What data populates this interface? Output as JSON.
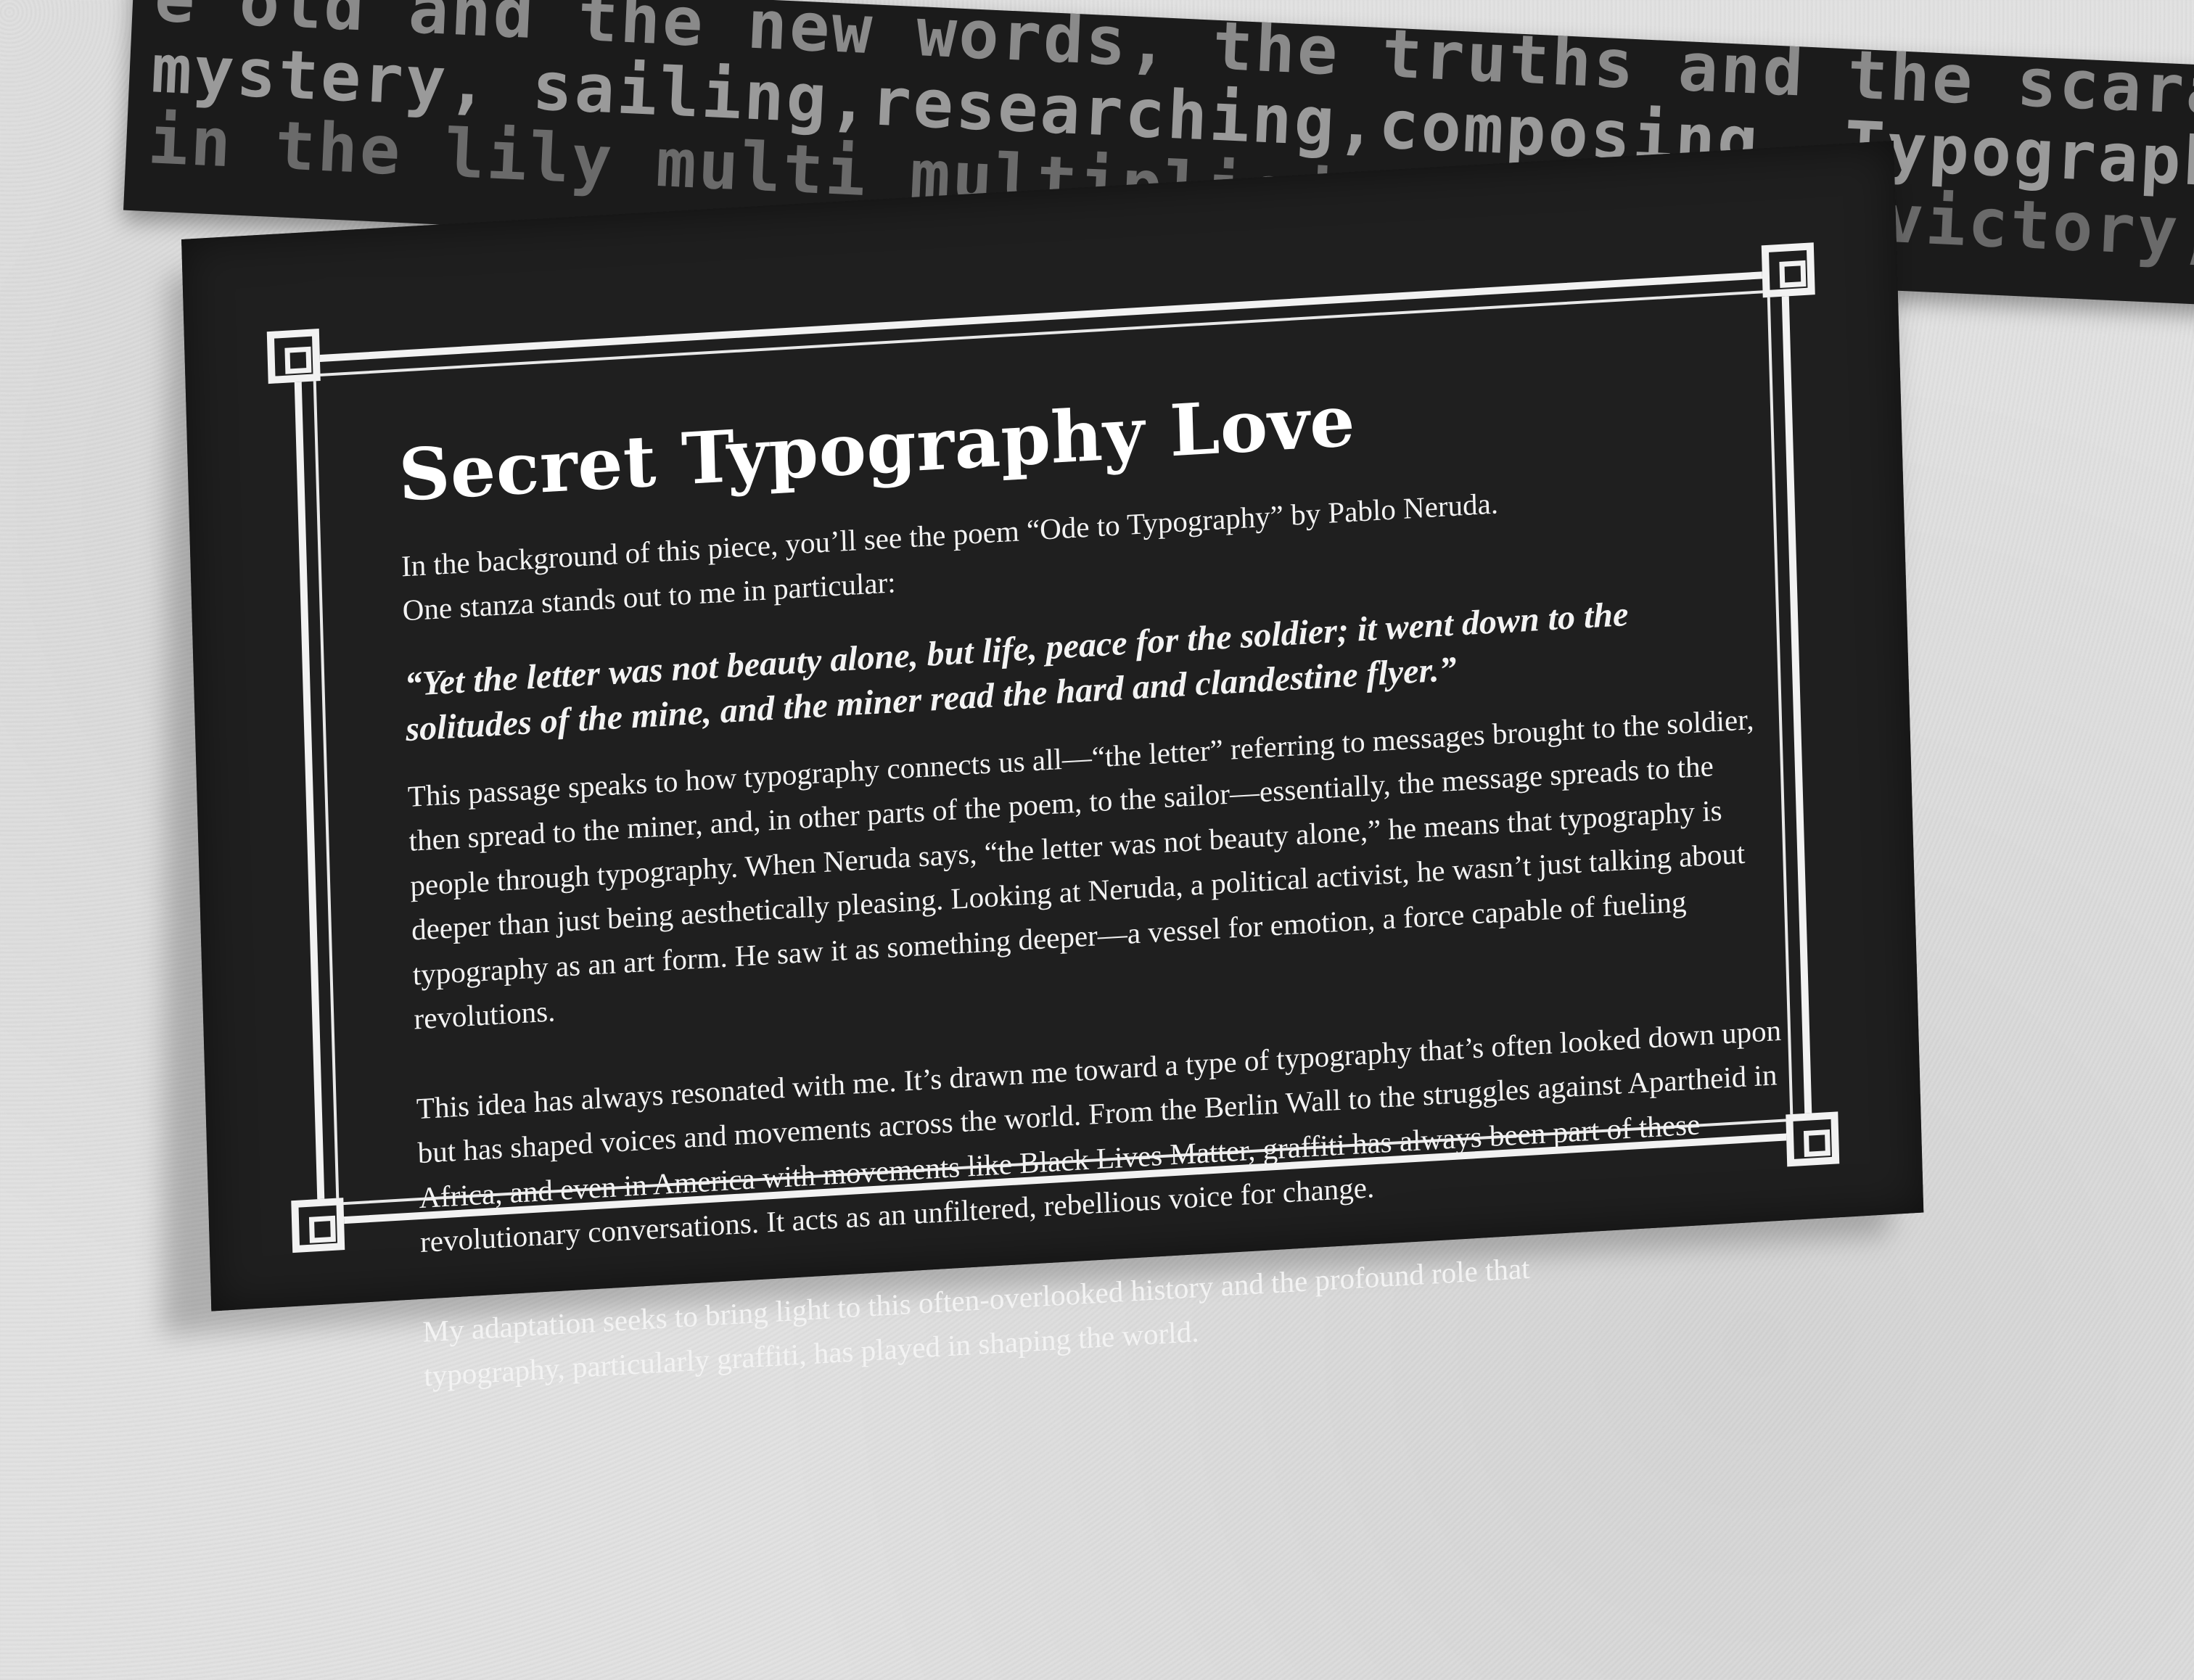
{
  "poem_background": {
    "lines": [
      "e old and the new words, the truths and the scarabs that sailed and conquered",
      "mystery, sailing,researching,composing. Typography, let me",
      "in the lily multi multiplied of the V of victory, in the E of"
    ]
  },
  "placard": {
    "title": "Secret Typography Love",
    "intro_line_1": "In the background of this piece, you’ll see the poem “Ode to Typography” by Pablo Neruda.",
    "intro_line_2": "One stanza stands out to me in particular:",
    "quote": "“Yet the letter was not beauty alone, but life, peace for the soldier; it went down to the solitudes of the mine, and the miner read the hard and clandestine flyer.”",
    "paragraph_1": "This passage speaks to how typography connects us all—“the letter” referring to messages brought to the soldier, then spread to the miner, and, in other parts of the poem, to the sailor—essentially, the message spreads to the people through typography. When Neruda says, “the letter was not beauty alone,” he means that typography is deeper than just being aesthetically pleasing. Looking at Neruda, a political activist, he wasn’t just talking about typography as an art form. He saw it as something deeper—a vessel for emotion, a force capable of fueling revolutions.",
    "paragraph_2": "This idea has always resonated with me. It’s drawn me toward a type of typography that’s often looked down upon but has shaped voices and movements across the world. From the Berlin Wall to the struggles against Apartheid in Africa, and even in America with movements like Black Lives Matter, graffiti has always been part of these revolutionary conversations. It acts as an unfiltered, rebellious voice for change.",
    "paragraph_3": "My adaptation seeks to bring light to this often-overlooked history and the profound role that typography, particularly graffiti, has played in shaping the world."
  }
}
